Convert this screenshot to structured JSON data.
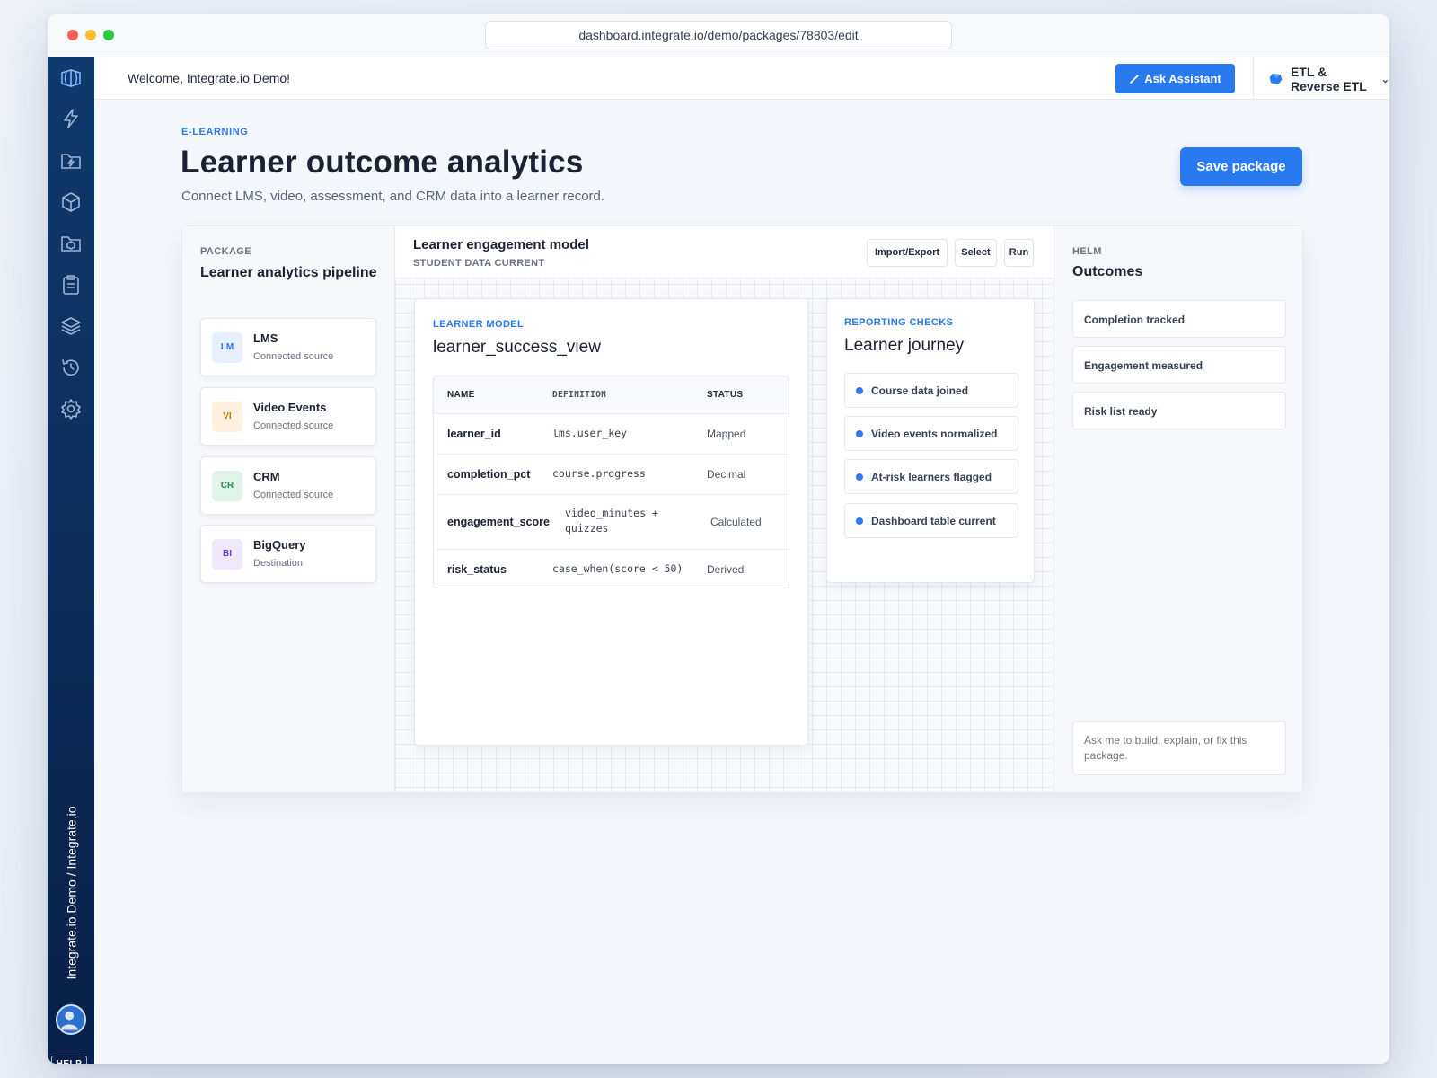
{
  "browser": {
    "url": "dashboard.integrate.io/demo/packages/78803/edit"
  },
  "sidebar": {
    "icons": [
      "integrate-logo-icon",
      "bolt-icon",
      "folder-bolt-icon",
      "cube-icon",
      "folder-cube-icon",
      "clipboard-icon",
      "layers-icon",
      "history-icon",
      "gear-icon"
    ],
    "account_label": "Integrate.io Demo / Integrate.io",
    "help_label": "HELP"
  },
  "topbar": {
    "welcome": "Welcome, Integrate.io Demo!",
    "assistant_label": "Ask Assistant",
    "product_selector": "ETL & Reverse ETL"
  },
  "header": {
    "category": "E-LEARNING",
    "title": "Learner outcome analytics",
    "subtitle": "Connect LMS, video, assessment, and CRM data into a learner record.",
    "save_label": "Save package"
  },
  "package": {
    "label": "PACKAGE",
    "title": "Learner analytics pipeline",
    "sources": [
      {
        "badge": "LM",
        "name": "LMS",
        "type": "Connected source",
        "color": "#2979f0",
        "bg": "#e8f0fd"
      },
      {
        "badge": "VI",
        "name": "Video Events",
        "type": "Connected source",
        "color": "#c47a12",
        "bg": "#fdf1df"
      },
      {
        "badge": "CR",
        "name": "CRM",
        "type": "Connected source",
        "color": "#1f8a4c",
        "bg": "#e2f4ea"
      },
      {
        "badge": "BI",
        "name": "BigQuery",
        "type": "Destination",
        "color": "#6d3fc9",
        "bg": "#efe8fb"
      }
    ]
  },
  "canvas": {
    "title": "Learner engagement model",
    "subtitle": "STUDENT DATA CURRENT",
    "toolbar": {
      "import_export": "Import/Export",
      "select": "Select",
      "run": "Run"
    },
    "model": {
      "label": "LEARNER MODEL",
      "title": "learner_success_view",
      "columns": {
        "name": "NAME",
        "definition": "DEFINITION",
        "status": "STATUS"
      },
      "rows": [
        {
          "name": "learner_id",
          "definition": "lms.user_key",
          "status": "Mapped"
        },
        {
          "name": "completion_pct",
          "definition": "course.progress",
          "status": "Decimal"
        },
        {
          "name": "engagement_score",
          "definition": "video_minutes + quizzes",
          "status": "Calculated"
        },
        {
          "name": "risk_status",
          "definition": "case_when(score < 50)",
          "status": "Derived"
        }
      ]
    },
    "checks": {
      "label": "REPORTING CHECKS",
      "title": "Learner journey",
      "items": [
        "Course data joined",
        "Video events normalized",
        "At-risk learners flagged",
        "Dashboard table current"
      ]
    }
  },
  "helm": {
    "label": "HELM",
    "title": "Outcomes",
    "outcomes": [
      "Completion tracked",
      "Engagement measured",
      "Risk list ready"
    ],
    "ask_placeholder": "Ask me to build, explain, or fix this package."
  },
  "colors": {
    "accent": "#2979f0",
    "sidebar": "#0b2a55"
  }
}
